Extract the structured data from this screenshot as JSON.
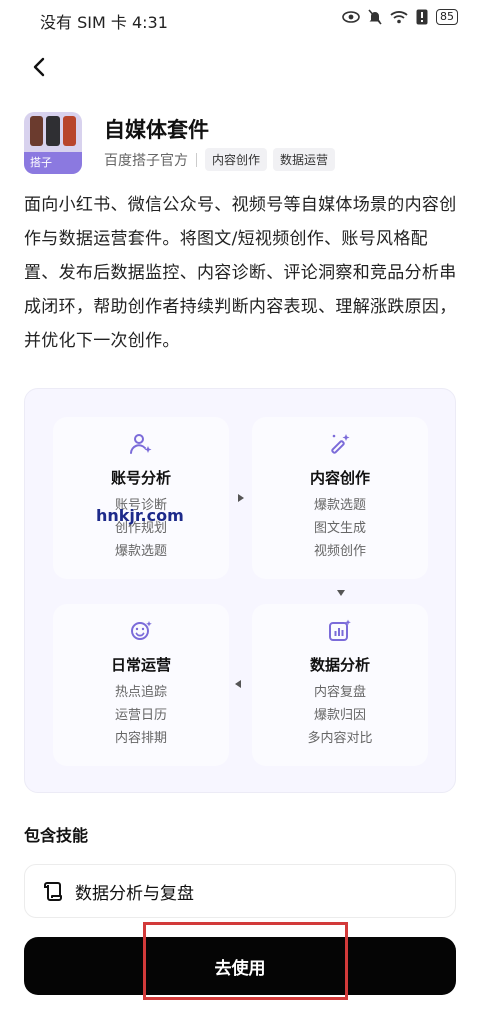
{
  "status_bar": {
    "left_text": "没有 SIM 卡 4:31",
    "battery": "85"
  },
  "header": {
    "icon_tag": "搭子",
    "title": "自媒体套件",
    "publisher": "百度搭子官方",
    "tags": [
      "内容创作",
      "数据运营"
    ]
  },
  "description": "面向小红书、微信公众号、视频号等自媒体场景的内容创作与数据运营套件。将图文/短视频创作、账号风格配置、发布后数据监控、内容诊断、评论洞察和竞品分析串成闭环，帮助创作者持续判断内容表现、理解涨跌原因，并优化下一次创作。",
  "workflow": {
    "cards": [
      {
        "title": "账号分析",
        "icon": "user-sparkle-icon",
        "items": [
          "账号诊断",
          "创作规划",
          "爆款选题"
        ]
      },
      {
        "title": "内容创作",
        "icon": "magic-wand-icon",
        "items": [
          "爆款选题",
          "图文生成",
          "视频创作"
        ]
      },
      {
        "title": "日常运营",
        "icon": "smile-sparkle-icon",
        "items": [
          "热点追踪",
          "运营日历",
          "内容排期"
        ]
      },
      {
        "title": "数据分析",
        "icon": "chart-icon",
        "items": [
          "内容复盘",
          "爆款归因",
          "多内容对比"
        ]
      }
    ],
    "watermark": "hnkjr.com"
  },
  "skills": {
    "title": "包含技能",
    "items": [
      {
        "label": "数据分析与复盘",
        "icon": "scroll-icon"
      }
    ]
  },
  "cta": {
    "label": "去使用"
  },
  "colors": {
    "accent": "#7b6bd9",
    "highlight_box": "#d23a3a",
    "cta_bg": "#050505"
  }
}
